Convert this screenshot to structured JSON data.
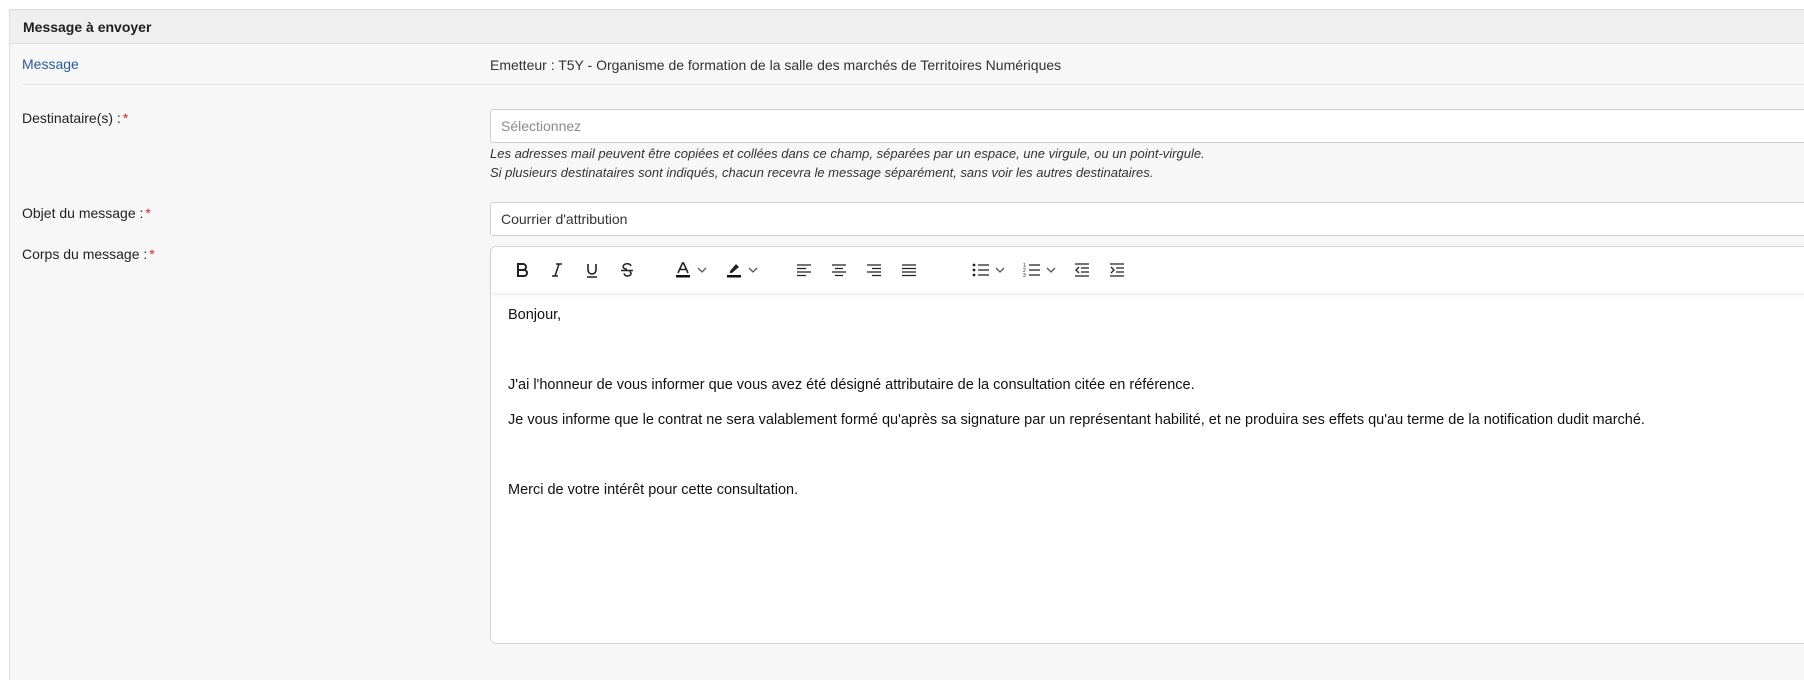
{
  "section": {
    "title": "Message à envoyer"
  },
  "message": {
    "label": "Message",
    "sender": "Emetteur : T5Y - Organisme de formation de la salle des marchés de Territoires Numériques"
  },
  "recipients": {
    "label": "Destinataire(s) :",
    "required_mark": "*",
    "placeholder": "Sélectionnez",
    "help_line1": "Les adresses mail peuvent être copiées et collées dans ce champ, séparées par un espace, une virgule, ou un point-virgule.",
    "help_line2": "Si plusieurs destinataires sont indiqués, chacun recevra le message séparément, sans voir les autres destinataires."
  },
  "subject": {
    "label": "Objet du message :",
    "required_mark": "*",
    "value": "Courrier d'attribution"
  },
  "body": {
    "label": "Corps du message :",
    "required_mark": "*",
    "toolbar": [
      {
        "name": "bold-button",
        "icon": "bold-icon"
      },
      {
        "name": "italic-button",
        "icon": "italic-icon"
      },
      {
        "name": "underline-button",
        "icon": "underline-icon"
      },
      {
        "name": "strikethrough-button",
        "icon": "strikethrough-icon"
      },
      {
        "name": "font-color-button",
        "icon": "font-color-icon"
      },
      {
        "name": "highlight-button",
        "icon": "highlight-icon"
      },
      {
        "name": "align-left-button",
        "icon": "align-left-icon"
      },
      {
        "name": "align-center-button",
        "icon": "align-center-icon"
      },
      {
        "name": "align-right-button",
        "icon": "align-right-icon"
      },
      {
        "name": "align-justify-button",
        "icon": "align-justify-icon"
      },
      {
        "name": "bulleted-list-button",
        "icon": "bulleted-list-icon"
      },
      {
        "name": "numbered-list-button",
        "icon": "numbered-list-icon"
      },
      {
        "name": "outdent-button",
        "icon": "outdent-icon"
      },
      {
        "name": "indent-button",
        "icon": "indent-icon"
      }
    ],
    "paragraphs": [
      "Bonjour,",
      "J'ai l'honneur de vous informer que vous avez été désigné attributaire de la consultation citée en référence.",
      "Je vous informe que le contrat ne sera valablement formé qu'après sa signature par un représentant habilité, et ne produira ses effets qu'au terme de la notification dudit marché.",
      "Merci de votre intérêt pour cette consultation."
    ]
  }
}
